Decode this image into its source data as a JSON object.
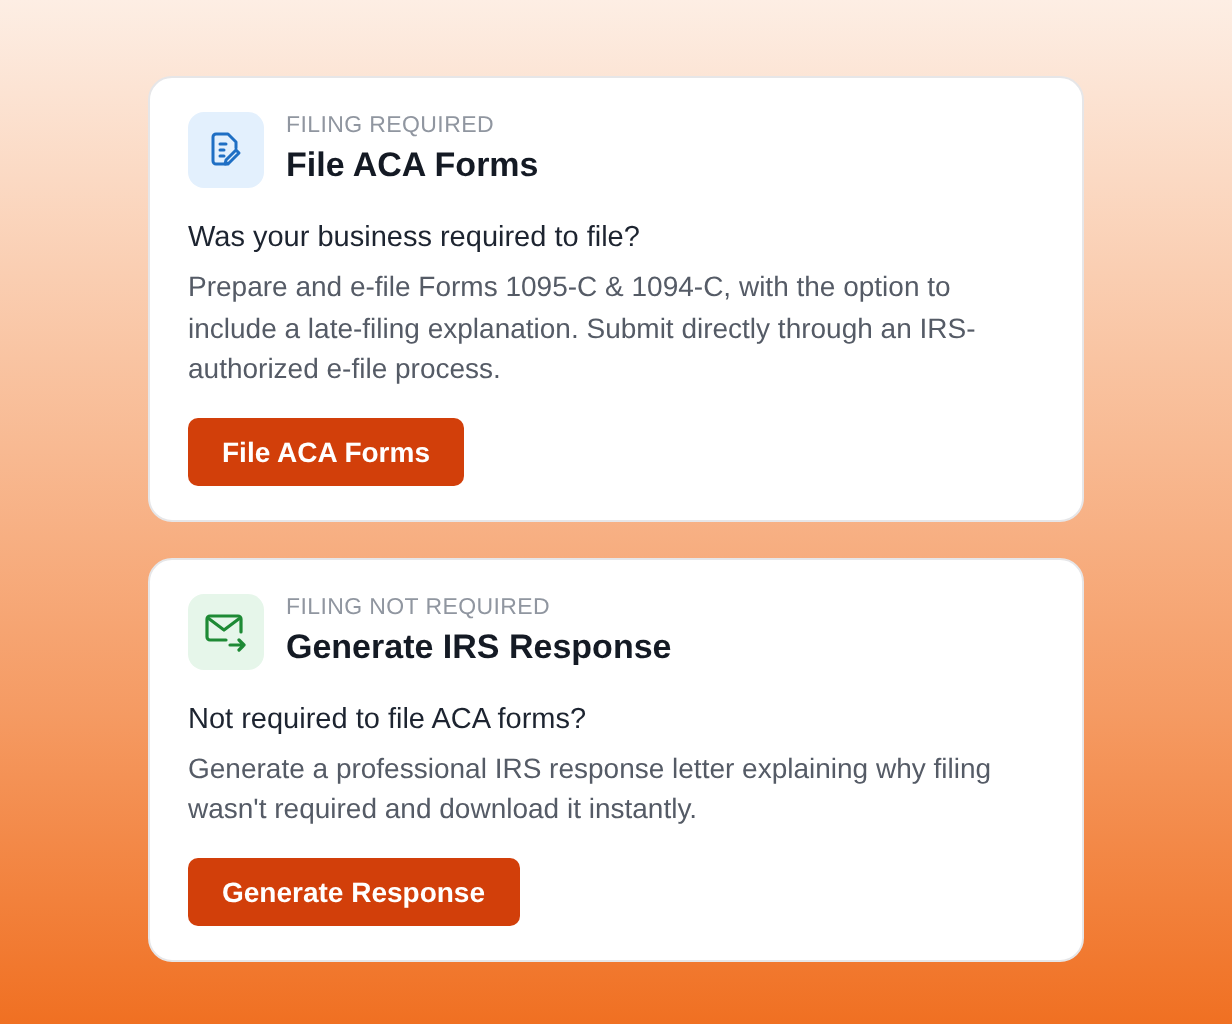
{
  "cards": [
    {
      "kind": "document",
      "eyebrow": "FILING REQUIRED",
      "title": "File ACA Forms",
      "question": "Was your business required to file?",
      "description": "Prepare and e-file Forms 1095-C & 1094-C, with the option to include a late-filing explanation. Submit directly through an IRS-authorized e-file process.",
      "button": "File ACA Forms"
    },
    {
      "kind": "mail",
      "eyebrow": "FILING NOT REQUIRED",
      "title": "Generate IRS Response",
      "question": "Not required to file ACA forms?",
      "description": "Generate a professional IRS response letter explaining why filing wasn't required and download it instantly.",
      "button": "Generate Response"
    }
  ]
}
